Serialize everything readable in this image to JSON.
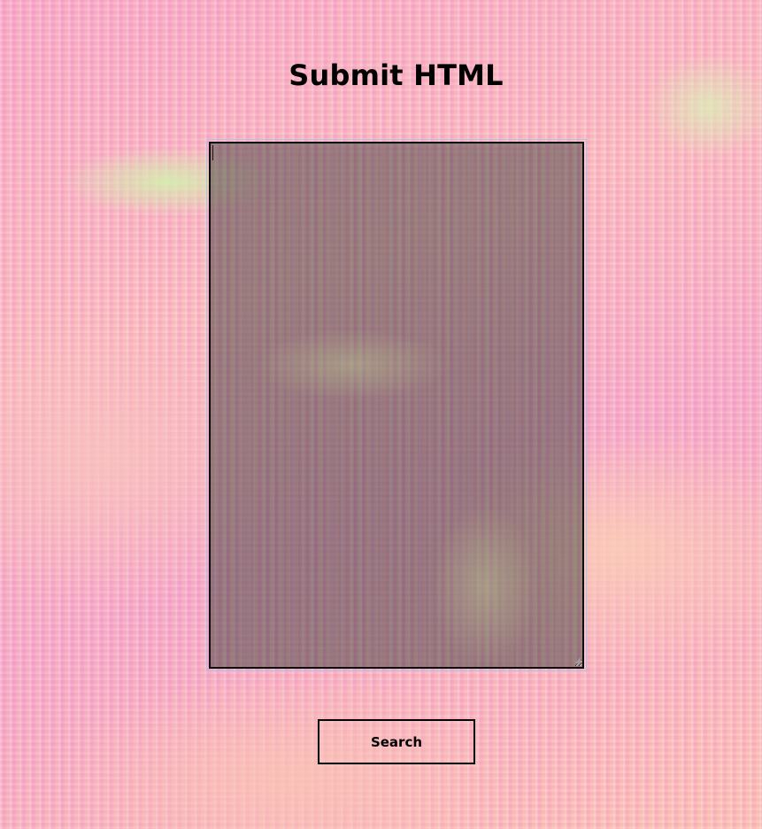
{
  "page": {
    "title": "Submit HTML"
  },
  "editor": {
    "value": "",
    "placeholder": ""
  },
  "search_button": {
    "label": "Search"
  },
  "colors": {
    "title_text": "#000000",
    "editor_border": "#0d0d0d",
    "editor_focus_ring": "#a9c6e6",
    "editor_overlay": "#3c3c3c",
    "button_border": "#000000",
    "background_pink": "#f6b4c4",
    "background_green_accent": "#d6ecb0"
  },
  "icons": {
    "resize_grip": "resize-grip-icon"
  }
}
